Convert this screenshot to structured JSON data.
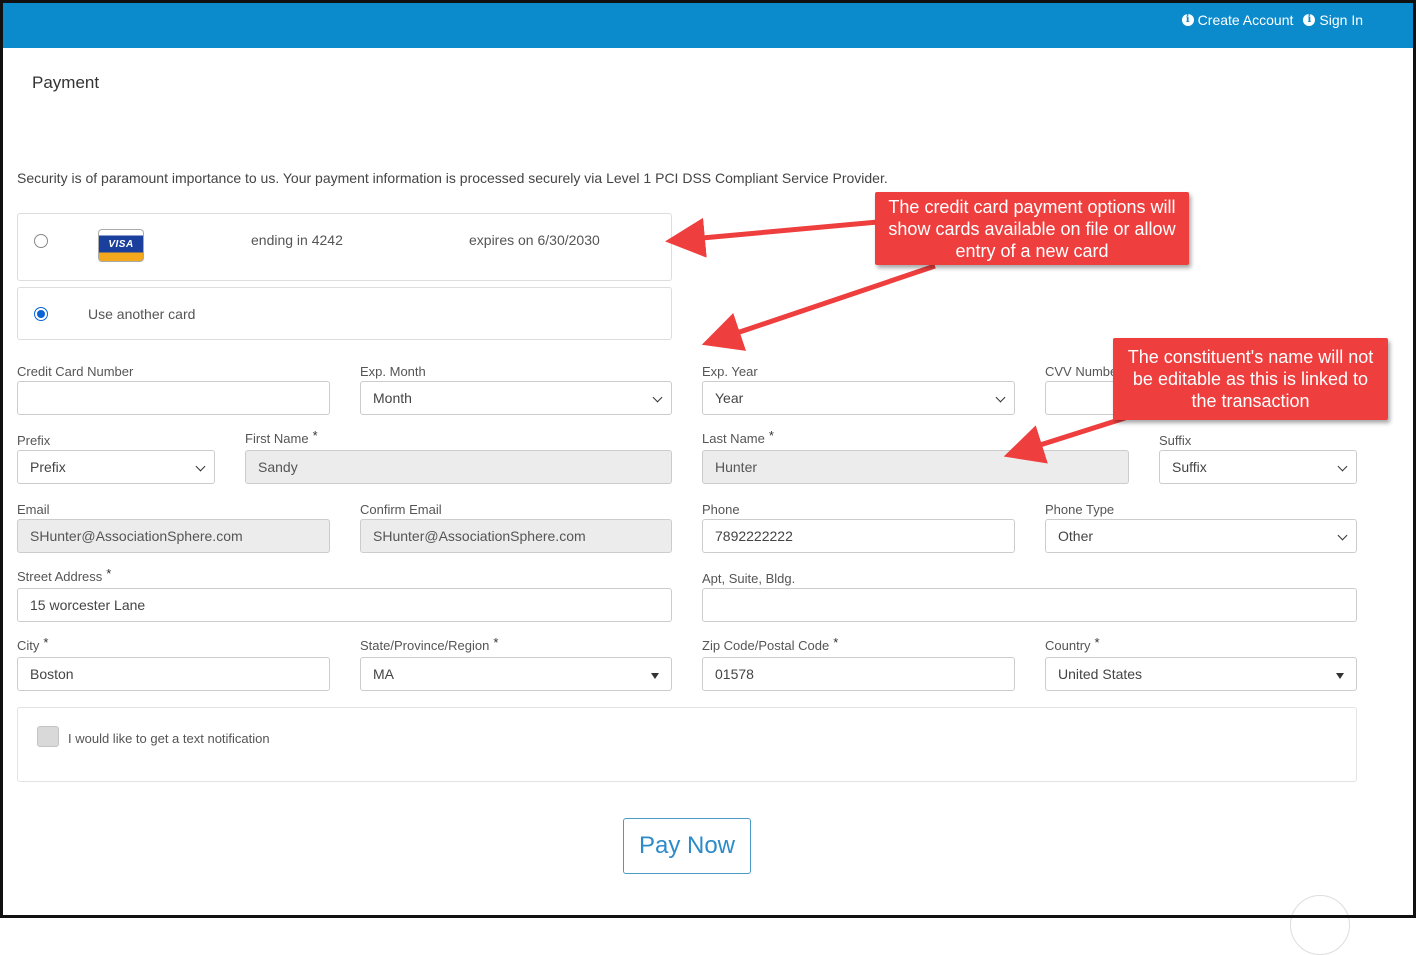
{
  "header": {
    "create_account": "Create Account",
    "sign_in": "Sign In"
  },
  "page": {
    "title": "Payment",
    "security_note": "Security is of paramount importance to us. Your payment information is processed securely via Level 1 PCI DSS Compliant Service Provider."
  },
  "cards": {
    "saved": {
      "brand": "VISA",
      "ending": "ending in 4242",
      "expires": "expires on 6/30/2030",
      "selected": false
    },
    "other": {
      "label": "Use another card",
      "selected": true
    }
  },
  "form": {
    "card_number": {
      "label": "Credit Card Number",
      "value": ""
    },
    "exp_month": {
      "label": "Exp. Month",
      "value": "Month"
    },
    "exp_year": {
      "label": "Exp. Year",
      "value": "Year"
    },
    "cvv": {
      "label": "CVV Number",
      "value": ""
    },
    "prefix": {
      "label": "Prefix",
      "value": "Prefix"
    },
    "first_name": {
      "label": "First Name",
      "value": "Sandy",
      "required": true
    },
    "last_name": {
      "label": "Last Name",
      "value": "Hunter",
      "required": true
    },
    "suffix": {
      "label": "Suffix",
      "value": "Suffix"
    },
    "email": {
      "label": "Email",
      "value": "SHunter@AssociationSphere.com"
    },
    "confirm_email": {
      "label": "Confirm Email",
      "value": "SHunter@AssociationSphere.com"
    },
    "phone": {
      "label": "Phone",
      "value": "7892222222"
    },
    "phone_type": {
      "label": "Phone Type",
      "value": "Other"
    },
    "street": {
      "label": "Street Address",
      "value": "15 worcester Lane",
      "required": true
    },
    "apt": {
      "label": "Apt, Suite, Bldg.",
      "value": ""
    },
    "city": {
      "label": "City",
      "value": "Boston",
      "required": true
    },
    "state": {
      "label": "State/Province/Region",
      "value": "MA",
      "required": true
    },
    "zip": {
      "label": "Zip Code/Postal Code",
      "value": "01578",
      "required": true
    },
    "country": {
      "label": "Country",
      "value": "United States",
      "required": true
    },
    "required_mark": "*",
    "text_notification": {
      "label": "I would like to get a text notification",
      "checked": false
    }
  },
  "actions": {
    "pay_now": "Pay Now"
  },
  "annotations": {
    "card_options": "The credit card payment options will show cards available on file or allow entry of a new card",
    "name_not_editable": "The constituent's name will not be editable as this is linked to the transaction"
  },
  "colors": {
    "header_bar": "#0b8bcb",
    "callout": "#ee3e3e",
    "radio_selected": "#0a63d6",
    "pay_button_text": "#2d8bc9"
  }
}
